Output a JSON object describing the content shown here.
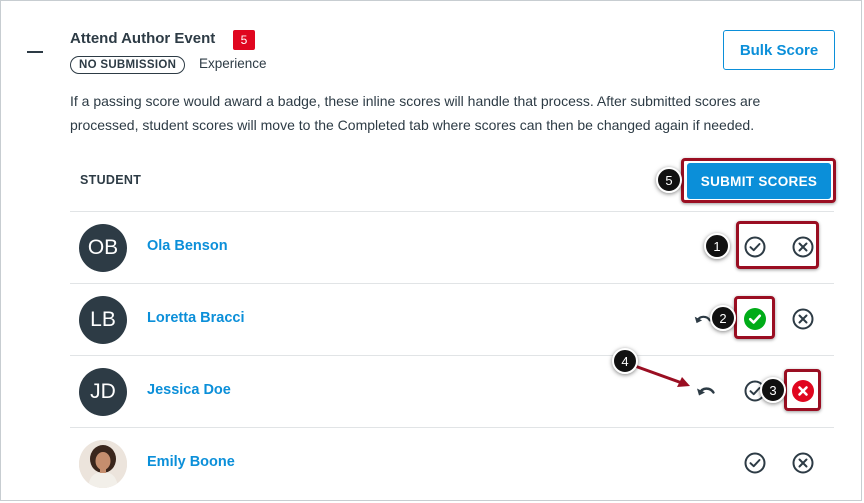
{
  "event": {
    "title": "Attend Author Event",
    "count_badge": "5",
    "status_pill": "NO SUBMISSION",
    "type": "Experience",
    "bulk_score_label": "Bulk Score",
    "description": "If a passing score would award a badge, these inline scores will handle that process. After submitted scores are processed, student scores will move to the Completed tab where scores can then be changed again if needed."
  },
  "table": {
    "column_header": "STUDENT",
    "submit_label": "SUBMIT SCORES",
    "students": [
      {
        "initials": "OB",
        "name": "Ola Benson",
        "state": "none"
      },
      {
        "initials": "LB",
        "name": "Loretta Bracci",
        "state": "pass"
      },
      {
        "initials": "JD",
        "name": "Jessica Doe",
        "state": "fail"
      },
      {
        "initials": "",
        "name": "Emily Boone",
        "state": "none"
      }
    ]
  },
  "callouts": [
    "1",
    "2",
    "3",
    "4",
    "5"
  ],
  "colors": {
    "accent": "#0b8fd9",
    "badge": "#e0061f",
    "pass": "#00ac18",
    "fail": "#e0061f",
    "highlight": "#9a0e22",
    "text": "#2d3b45"
  },
  "icons": {
    "pass": "check-circle-icon",
    "fail": "x-circle-icon",
    "undo": "undo-icon",
    "collapse": "minus-icon"
  }
}
